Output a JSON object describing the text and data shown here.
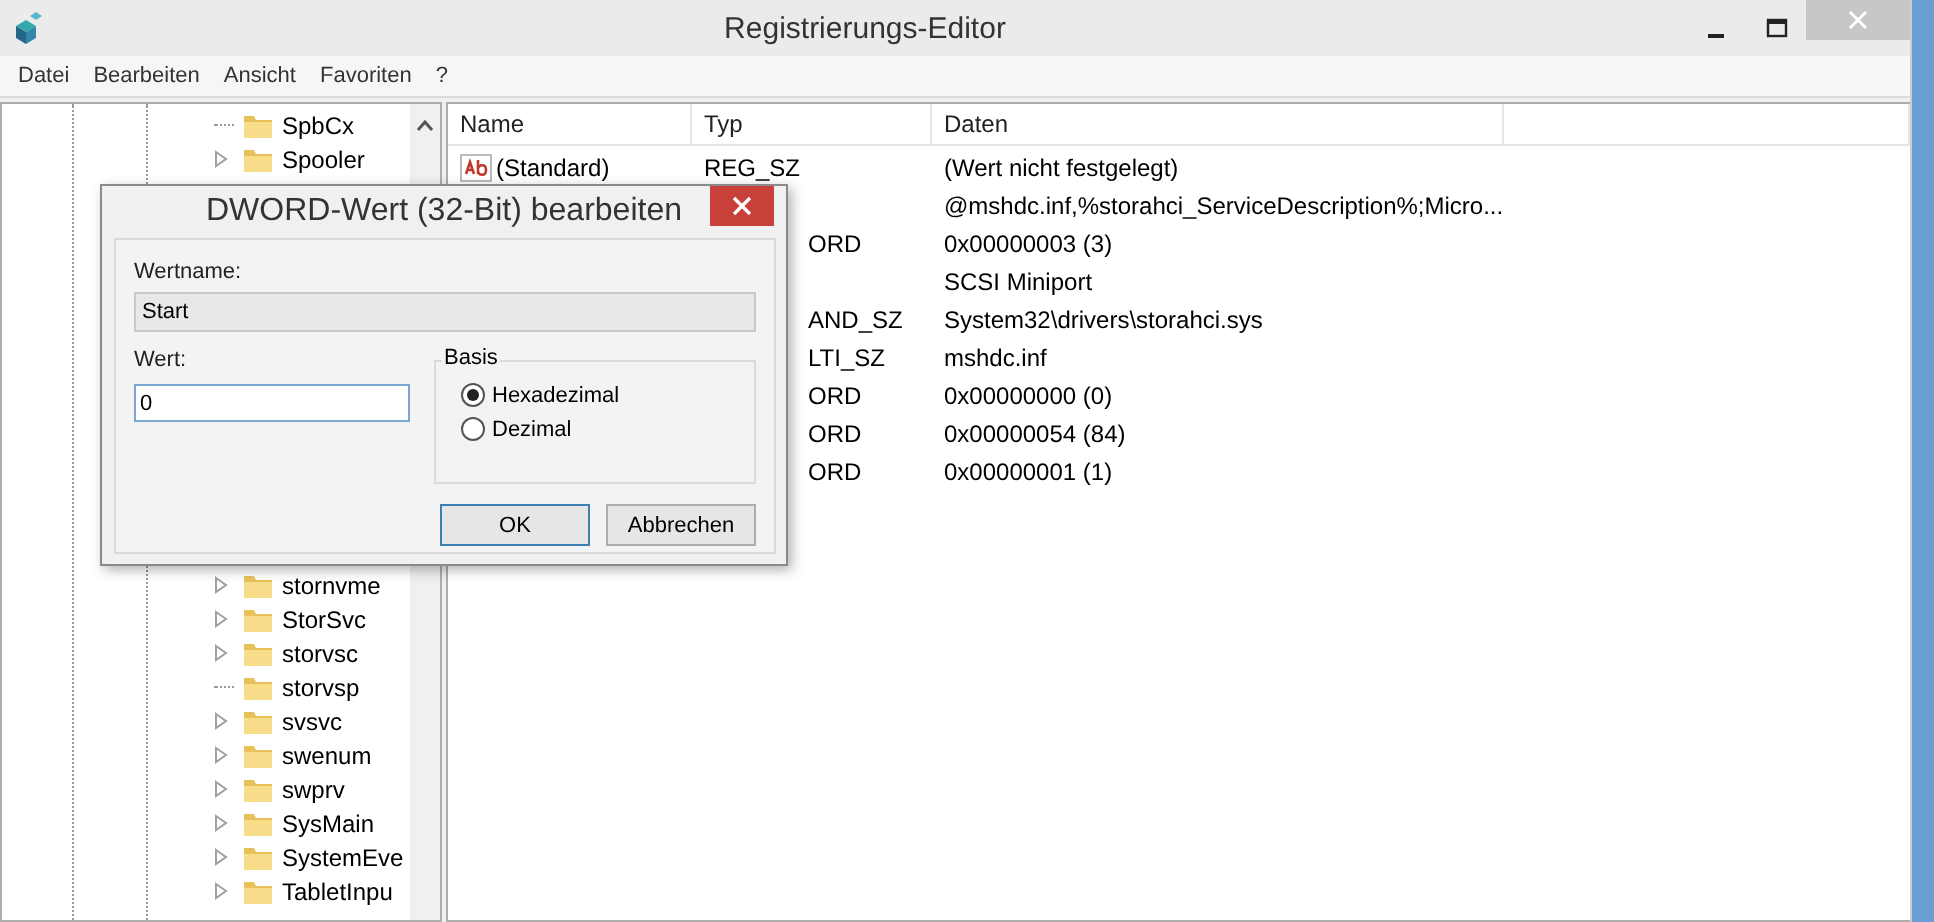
{
  "window": {
    "title": "Registrierungs-Editor"
  },
  "menu": [
    "Datei",
    "Bearbeiten",
    "Ansicht",
    "Favoriten",
    "?"
  ],
  "tree": {
    "items": [
      {
        "label": "SpbCx",
        "expandable": false
      },
      {
        "label": "Spooler",
        "expandable": true
      },
      {
        "label": "stornvme",
        "expandable": true
      },
      {
        "label": "StorSvc",
        "expandable": true
      },
      {
        "label": "storvsc",
        "expandable": true
      },
      {
        "label": "storvsp",
        "expandable": false
      },
      {
        "label": "svsvc",
        "expandable": true
      },
      {
        "label": "swenum",
        "expandable": true
      },
      {
        "label": "swprv",
        "expandable": true
      },
      {
        "label": "SysMain",
        "expandable": true
      },
      {
        "label": "SystemEve",
        "expandable": true
      },
      {
        "label": "TabletInpu",
        "expandable": true
      }
    ]
  },
  "values": {
    "columns": [
      "Name",
      "Typ",
      "Daten"
    ],
    "rows": [
      {
        "name": "(Standard)",
        "type": "REG_SZ",
        "data": "(Wert nicht festgelegt)"
      },
      {
        "data": "@mshdc.inf,%storahci_ServiceDescription%;Micro..."
      },
      {
        "type": "ORD",
        "data": "0x00000003 (3)"
      },
      {
        "data": "SCSI Miniport"
      },
      {
        "type": "AND_SZ",
        "data": "System32\\drivers\\storahci.sys"
      },
      {
        "type": "LTI_SZ",
        "data": "mshdc.inf"
      },
      {
        "type": "ORD",
        "data": "0x00000000 (0)"
      },
      {
        "type": "ORD",
        "data": "0x00000054 (84)"
      },
      {
        "type": "ORD",
        "data": "0x00000001 (1)"
      }
    ]
  },
  "dialog": {
    "title": "DWORD-Wert (32-Bit) bearbeiten",
    "name_label": "Wertname:",
    "name_value": "Start",
    "value_label": "Wert:",
    "value": "0",
    "base_label": "Basis",
    "bases": [
      {
        "label": "Hexadezimal",
        "selected": true
      },
      {
        "label": "Dezimal",
        "selected": false
      }
    ],
    "buttons": [
      "OK",
      "Abbrechen"
    ]
  }
}
